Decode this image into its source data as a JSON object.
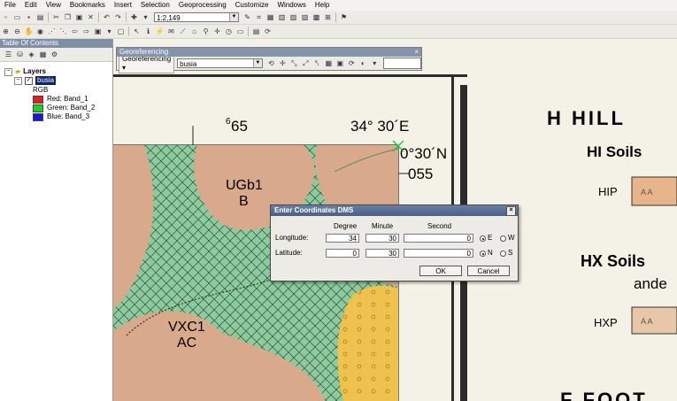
{
  "menu": [
    "File",
    "Edit",
    "View",
    "Bookmarks",
    "Insert",
    "Selection",
    "Geoprocessing",
    "Customize",
    "Windows",
    "Help"
  ],
  "toolbar": {
    "scale": "1:2,149"
  },
  "toc": {
    "title": "Table Of Contents",
    "root_label": "Layers",
    "layer_label": "busia",
    "rgb_label": "RGB",
    "bands": [
      {
        "label": "Red:   Band_1",
        "color": "#e02020"
      },
      {
        "label": "Green: Band_2",
        "color": "#20d020"
      },
      {
        "label": "Blue:  Band_3",
        "color": "#1a1ad8"
      }
    ]
  },
  "georeferencing": {
    "title": "Georeferencing",
    "menu_label": "Georeferencing ▾",
    "layer": "busia"
  },
  "map": {
    "label_65": "65",
    "label_6": "6",
    "label_lon": "34° 30´E",
    "label_lat": "0°30´N",
    "label_055": "055",
    "label_ugb1": "UGb1",
    "label_b": "B",
    "label_vxc1": "VXC1",
    "label_ac": "AC",
    "legend_h": "H  HILL",
    "legend_hi": "HI  Soils",
    "legend_hip": "HIP",
    "legend_hx": "HX  Soils",
    "legend_ande": "ande",
    "legend_hxp": "HXP",
    "legend_bottom": "F  FOOT",
    "pattern_text": "A A"
  },
  "dialog": {
    "title": "Enter Coordinates DMS",
    "col_degree": "Degree",
    "col_minute": "Minute",
    "col_second": "Second",
    "longitude_label": "Longitude:",
    "latitude_label": "Latitude:",
    "lon": {
      "degree": "34",
      "minute": "30",
      "second": "0"
    },
    "lat": {
      "degree": "0",
      "minute": "30",
      "second": "0"
    },
    "lon_dirs": [
      "E",
      "W"
    ],
    "lat_dirs": [
      "N",
      "S"
    ],
    "ok": "OK",
    "cancel": "Cancel"
  },
  "colors": {
    "polygon_green": "#8dcb9e",
    "polygon_tan": "#d9a98b",
    "polygon_orange": "#efc24e"
  }
}
